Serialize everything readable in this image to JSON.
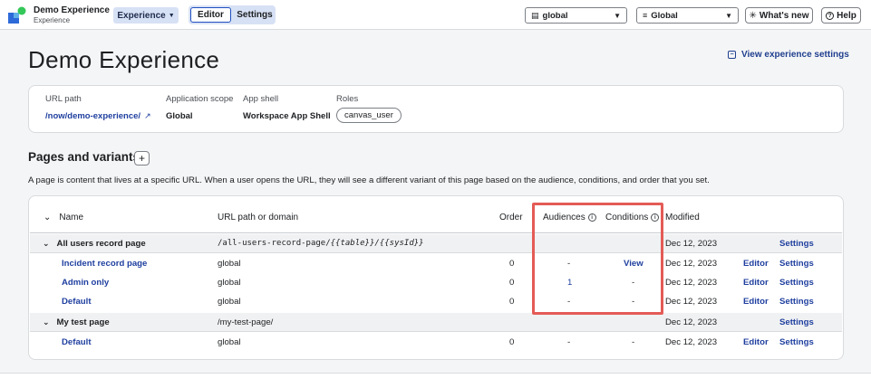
{
  "app": {
    "title": "Demo Experience",
    "subtitle": "Experience",
    "experience_menu": "Experience",
    "tabs": {
      "editor": "Editor",
      "settings": "Settings"
    },
    "scope_select": "global",
    "global_select": "Global",
    "whats_new": "What's new",
    "help": "Help"
  },
  "header": {
    "title": "Demo Experience",
    "view_settings": "View experience settings"
  },
  "info": {
    "url_path_label": "URL path",
    "url_path_value": "/now/demo-experience/",
    "scope_label": "Application scope",
    "scope_value": "Global",
    "shell_label": "App shell",
    "shell_value": "Workspace App Shell",
    "roles_label": "Roles",
    "roles": [
      "canvas_user"
    ]
  },
  "pages": {
    "title": "Pages and variants",
    "add_label": "+",
    "description": "A page is content that lives at a specific URL. When a user opens the URL, they will see a different variant of this page based on the audience, conditions, and order that you set."
  },
  "table": {
    "columns": {
      "name": "Name",
      "url": "URL path or domain",
      "order": "Order",
      "audiences": "Audiences",
      "conditions": "Conditions",
      "modified": "Modified"
    },
    "groups": [
      {
        "name": "All users record page",
        "url_prefix": "/all-users-record-page/",
        "url_mono": "{{table}}/{{sysId}}",
        "modified": "Dec 12, 2023",
        "settings": "Settings",
        "variants": [
          {
            "name": "Incident record page",
            "url": "global",
            "order": "0",
            "audiences": "-",
            "conditions": "View",
            "modified": "Dec 12, 2023",
            "editor": "Editor",
            "settings": "Settings"
          },
          {
            "name": "Admin only",
            "url": "global",
            "order": "0",
            "audiences": "1",
            "conditions": "-",
            "modified": "Dec 12, 2023",
            "editor": "Editor",
            "settings": "Settings"
          },
          {
            "name": "Default",
            "url": "global",
            "order": "0",
            "audiences": "-",
            "conditions": "-",
            "modified": "Dec 12, 2023",
            "editor": "Editor",
            "settings": "Settings"
          }
        ]
      },
      {
        "name": "My test page",
        "url_prefix": "/my-test-page/",
        "url_mono": "",
        "modified": "Dec 12, 2023",
        "settings": "Settings",
        "variants": [
          {
            "name": "Default",
            "url": "global",
            "order": "0",
            "audiences": "-",
            "conditions": "-",
            "modified": "Dec 12, 2023",
            "editor": "Editor",
            "settings": "Settings"
          }
        ]
      }
    ]
  },
  "colors": {
    "link": "#1f3f9f",
    "highlight": "#e45b56",
    "accent_bg": "#d7e1f5"
  }
}
